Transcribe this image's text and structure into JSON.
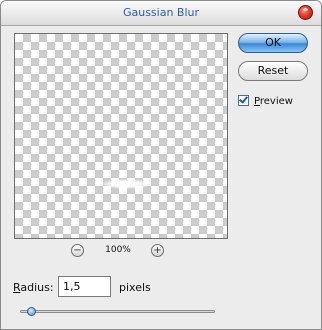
{
  "dialog": {
    "title": "Gaussian Blur"
  },
  "buttons": {
    "ok_label": "OK",
    "reset_label": "Reset"
  },
  "preview_option": {
    "label_first": "P",
    "label_rest": "review",
    "checked": true
  },
  "zoom": {
    "level": "100%",
    "out_symbol": "−",
    "in_symbol": "+"
  },
  "radius": {
    "label_first": "R",
    "label_rest": "adius:",
    "value": "1,5",
    "units": "pixels"
  },
  "slider": {
    "level_fraction": 0.06
  },
  "colors": {
    "title_text": "#2b5ea8",
    "ok_button": "#3a88d8",
    "close_button": "#e53b2c"
  },
  "icons": {
    "close": "close-icon",
    "zoom_out": "zoom-out-icon",
    "zoom_in": "zoom-in-icon",
    "checkbox": "checkbox-check-icon"
  }
}
